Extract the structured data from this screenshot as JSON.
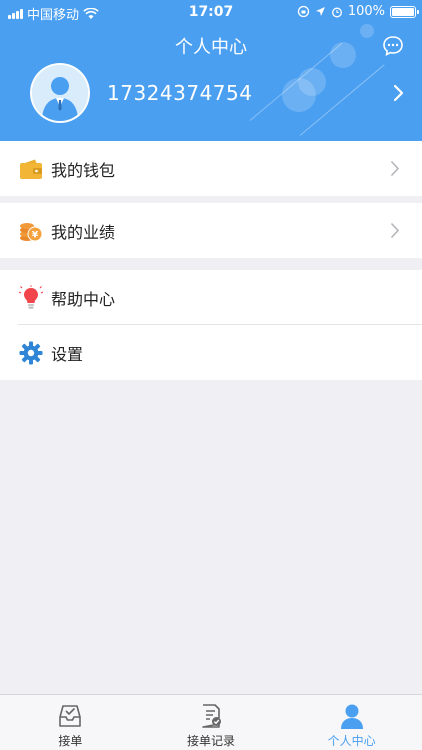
{
  "status_bar": {
    "carrier": "中国移动",
    "time": "17:07",
    "battery": "100%"
  },
  "header": {
    "title": "个人中心",
    "message_icon": "chat-bubble-icon"
  },
  "profile": {
    "phone": "17324374754",
    "avatar_icon": "user-avatar-icon"
  },
  "menu": {
    "wallet": {
      "label": "我的钱包",
      "icon": "wallet-icon"
    },
    "performance": {
      "label": "我的业绩",
      "icon": "coins-icon"
    },
    "help": {
      "label": "帮助中心",
      "icon": "lightbulb-icon"
    },
    "settings": {
      "label": "设置",
      "icon": "gear-icon"
    }
  },
  "tabbar": {
    "orders": {
      "label": "接单",
      "icon": "inbox-icon"
    },
    "records": {
      "label": "接单记录",
      "icon": "document-check-icon"
    },
    "profile": {
      "label": "个人中心",
      "icon": "person-icon"
    }
  },
  "colors": {
    "primary": "#4a9ff1",
    "background": "#efeff4"
  }
}
